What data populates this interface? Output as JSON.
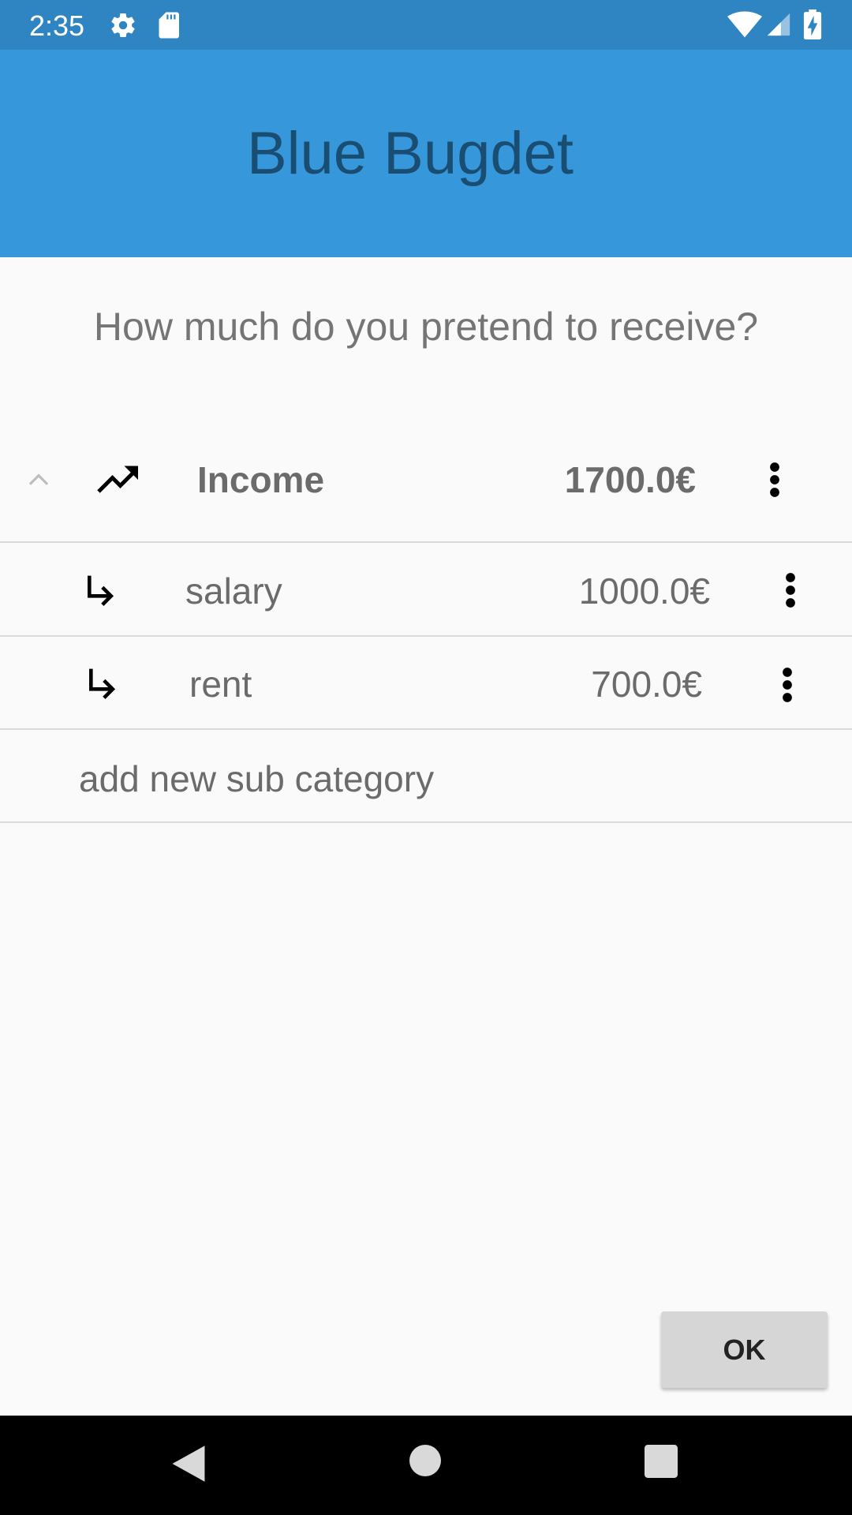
{
  "status_bar": {
    "time": "2:35",
    "icons": [
      "gear-icon",
      "sd-card-icon",
      "wifi-icon",
      "signal-icon",
      "battery-charging-icon"
    ]
  },
  "app_bar": {
    "title": "Blue Bugdet",
    "background": "#3697da",
    "title_color": "#1a4d72"
  },
  "question": "How much do you pretend to receive?",
  "category": {
    "name": "Income",
    "amount": "1700.0€",
    "expanded": true,
    "icons": [
      "chevron-up-icon",
      "trending-up-icon",
      "more-vert-icon"
    ]
  },
  "sub_categories": [
    {
      "name": "salary",
      "amount": "1000.0€"
    },
    {
      "name": "rent",
      "amount": "700.0€"
    }
  ],
  "add_sub_category": "add new sub category",
  "ok_button": "OK",
  "nav_bar": {
    "icons": [
      "back-icon",
      "home-icon",
      "recent-apps-icon"
    ]
  }
}
